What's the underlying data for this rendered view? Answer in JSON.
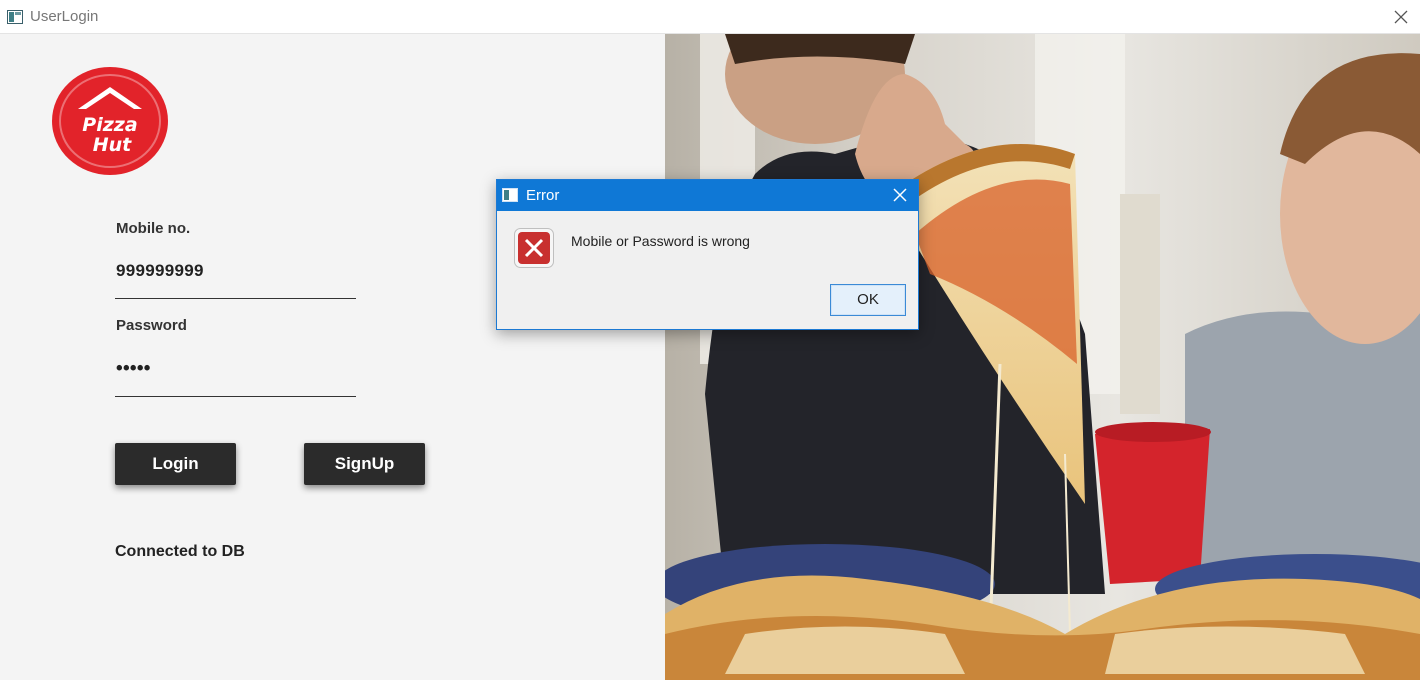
{
  "window": {
    "title": "UserLogin",
    "icon": "app-window-icon",
    "close_icon": "close-icon"
  },
  "brand": {
    "logo": "pizza-hut-logo",
    "logo_text_line1": "Pizza",
    "logo_text_line2": "Hut",
    "logo_color": "#e2232a"
  },
  "form": {
    "mobile_label": "Mobile no.",
    "mobile_value": "999999999",
    "password_label": "Password",
    "password_value": "•••••",
    "login_label": "Login",
    "signup_label": "SignUp",
    "status_text": "Connected to DB"
  },
  "dialog": {
    "title": "Error",
    "message": "Mobile or Password is wrong",
    "ok_label": "OK",
    "icon": "error-icon",
    "accent": "#0f78d6"
  }
}
